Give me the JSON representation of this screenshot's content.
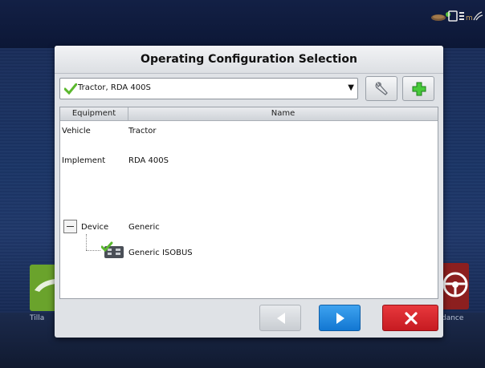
{
  "dialog": {
    "title": "Operating Configuration Selection"
  },
  "config_select": {
    "value": "Tractor, RDA 400S"
  },
  "table": {
    "headers": [
      "Equipment",
      "Name"
    ],
    "rows": [
      {
        "equipment": "Vehicle",
        "name": "Tractor"
      },
      {
        "equipment": "Implement",
        "name": "RDA 400S"
      },
      {
        "equipment": "Device",
        "name": "Generic"
      },
      {
        "equipment": "",
        "name": "Generic ISOBUS"
      }
    ]
  },
  "background": {
    "left_tile_label": "Tilla",
    "right_tile_label": "dance"
  },
  "colors": {
    "accent_blue": "#1e88e5",
    "cancel_red": "#d32228",
    "check_green": "#5bb82e"
  },
  "icons": {
    "status": [
      "implement-status-icon",
      "display-status-icon",
      "gps-signal-icon"
    ],
    "toolbar": [
      "wrench-icon",
      "plus-icon"
    ],
    "nav": [
      "back-arrow-icon",
      "next-arrow-icon",
      "close-icon"
    ]
  }
}
